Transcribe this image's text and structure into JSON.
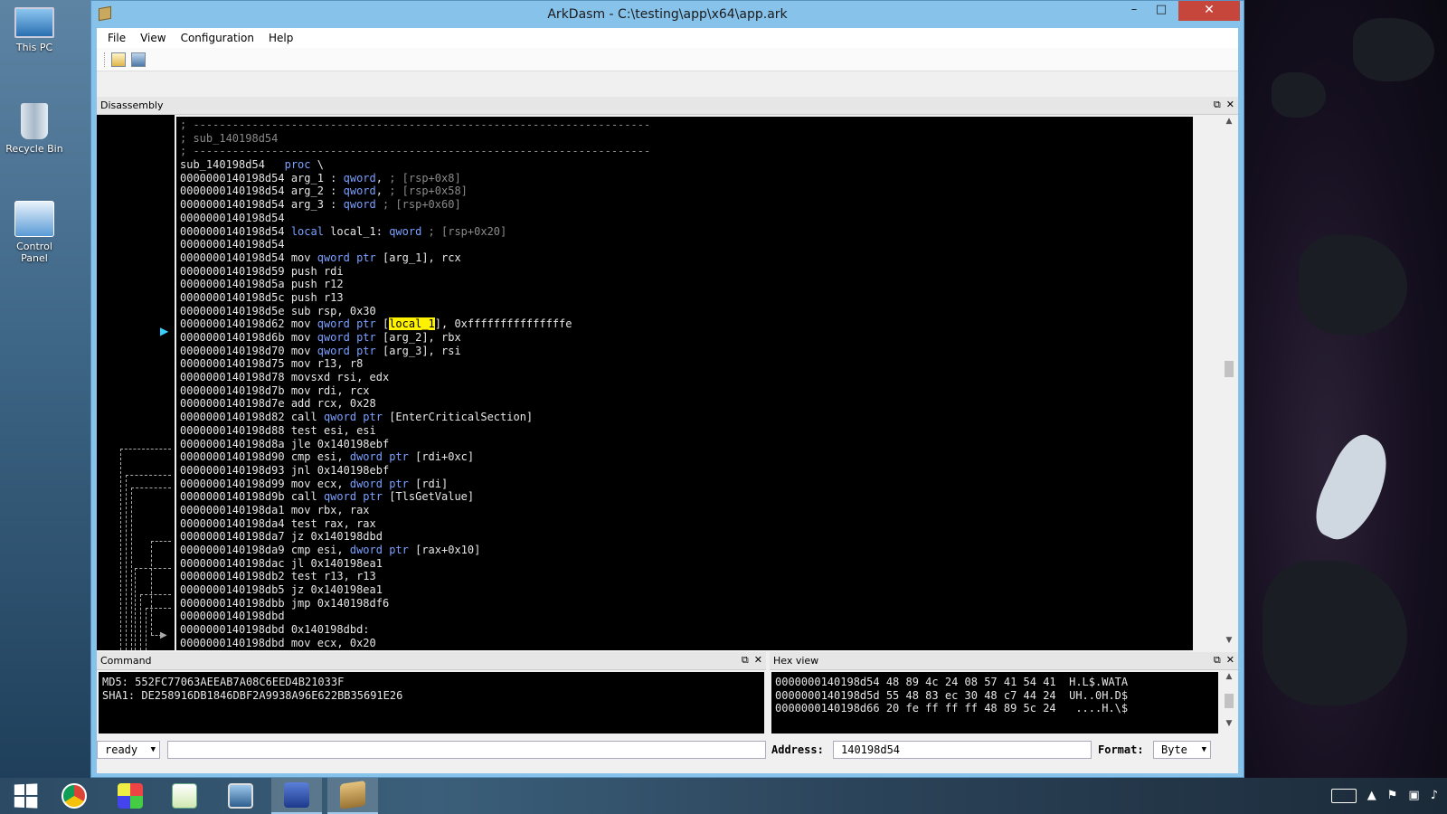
{
  "desktop": {
    "icons": [
      "This PC",
      "Recycle Bin",
      "Control Panel"
    ]
  },
  "window": {
    "title": "ArkDasm - C:\\testing\\app\\x64\\app.ark",
    "controls": {
      "minimize": "–",
      "maximize": "□",
      "close": "✕"
    }
  },
  "menu": [
    "File",
    "View",
    "Configuration",
    "Help"
  ],
  "toolbar": {
    "icons": [
      "open-icon",
      "save-icon"
    ]
  },
  "disassembly": {
    "title": "Disassembly",
    "header_icons": [
      "⧉",
      "✕"
    ],
    "lines": [
      {
        "t": "cmt",
        "text": "; ----------------------------------------------------------------------"
      },
      {
        "t": "cmt",
        "text": "; sub_140198d54"
      },
      {
        "t": "cmt",
        "text": "; ----------------------------------------------------------------------"
      },
      {
        "t": "proc",
        "addr": "sub_140198d54",
        "kw": "proc",
        "rest": " \\"
      },
      {
        "t": "arg",
        "addr": "0000000140198d54",
        "a": " arg_1 : ",
        "kw": "qword",
        "b": ", ",
        "cmt": "; [rsp+0x8]"
      },
      {
        "t": "arg",
        "addr": "0000000140198d54",
        "a": " arg_2 : ",
        "kw": "qword",
        "b": ", ",
        "cmt": "; [rsp+0x58]"
      },
      {
        "t": "arg",
        "addr": "0000000140198d54",
        "a": " arg_3 : ",
        "kw": "qword",
        "b": " ",
        "cmt": "; [rsp+0x60]"
      },
      {
        "t": "plain",
        "text": "0000000140198d54"
      },
      {
        "t": "local",
        "addr": "0000000140198d54",
        "kw1": "local",
        "a": " local_1: ",
        "kw": "qword",
        "cmt": " ; [rsp+0x20]"
      },
      {
        "t": "plain",
        "text": "0000000140198d54"
      },
      {
        "t": "ptr",
        "addr": "0000000140198d54",
        "op": " mov ",
        "kw": "qword ptr",
        "rest": " [arg_1], rcx"
      },
      {
        "t": "plain",
        "text": "0000000140198d59 push rdi"
      },
      {
        "t": "plain",
        "text": "0000000140198d5a push r12"
      },
      {
        "t": "plain",
        "text": "0000000140198d5c push r13"
      },
      {
        "t": "plain",
        "text": "0000000140198d5e sub rsp, 0x30"
      },
      {
        "t": "hl",
        "addr": "0000000140198d62",
        "op": " mov ",
        "kw": "qword ptr",
        "pre": " [",
        "hl": "local_1",
        "post": "], 0xfffffffffffffffe"
      },
      {
        "t": "ptr",
        "addr": "0000000140198d6b",
        "op": " mov ",
        "kw": "qword ptr",
        "rest": " [arg_2], rbx"
      },
      {
        "t": "ptr",
        "addr": "0000000140198d70",
        "op": " mov ",
        "kw": "qword ptr",
        "rest": " [arg_3], rsi"
      },
      {
        "t": "plain",
        "text": "0000000140198d75 mov r13, r8"
      },
      {
        "t": "plain",
        "text": "0000000140198d78 movsxd rsi, edx"
      },
      {
        "t": "plain",
        "text": "0000000140198d7b mov rdi, rcx"
      },
      {
        "t": "plain",
        "text": "0000000140198d7e add rcx, 0x28"
      },
      {
        "t": "ptr",
        "addr": "0000000140198d82",
        "op": " call ",
        "kw": "qword ptr",
        "rest": " [EnterCriticalSection]"
      },
      {
        "t": "plain",
        "text": "0000000140198d88 test esi, esi"
      },
      {
        "t": "plain",
        "text": "0000000140198d8a jle 0x140198ebf"
      },
      {
        "t": "ptr",
        "addr": "0000000140198d90",
        "op": " cmp esi, ",
        "kw": "dword ptr",
        "rest": " [rdi+0xc]"
      },
      {
        "t": "plain",
        "text": "0000000140198d93 jnl 0x140198ebf"
      },
      {
        "t": "ptr",
        "addr": "0000000140198d99",
        "op": " mov ecx, ",
        "kw": "dword ptr",
        "rest": " [rdi]"
      },
      {
        "t": "ptr",
        "addr": "0000000140198d9b",
        "op": " call ",
        "kw": "qword ptr",
        "rest": " [TlsGetValue]"
      },
      {
        "t": "plain",
        "text": "0000000140198da1 mov rbx, rax"
      },
      {
        "t": "plain",
        "text": "0000000140198da4 test rax, rax"
      },
      {
        "t": "plain",
        "text": "0000000140198da7 jz 0x140198dbd"
      },
      {
        "t": "ptr",
        "addr": "0000000140198da9",
        "op": " cmp esi, ",
        "kw": "dword ptr",
        "rest": " [rax+0x10]"
      },
      {
        "t": "plain",
        "text": "0000000140198dac jl 0x140198ea1"
      },
      {
        "t": "plain",
        "text": "0000000140198db2 test r13, r13"
      },
      {
        "t": "plain",
        "text": "0000000140198db5 jz 0x140198ea1"
      },
      {
        "t": "plain",
        "text": "0000000140198dbb jmp 0x140198df6"
      },
      {
        "t": "plain",
        "text": "0000000140198dbd"
      },
      {
        "t": "plain",
        "text": "0000000140198dbd 0x140198dbd:"
      },
      {
        "t": "plain",
        "text": "0000000140198dbd mov ecx, 0x20"
      }
    ]
  },
  "command": {
    "title": "Command",
    "header_icons": [
      "⧉",
      "✕"
    ],
    "output": "MD5: 552FC77063AEEAB7A08C6EED4B21033F\nSHA1: DE258916DB1846DBF2A9938A96E622BB35691E26"
  },
  "hexview": {
    "title": "Hex view",
    "header_icons": [
      "⧉",
      "✕"
    ],
    "output": "0000000140198d54 48 89 4c 24 08 57 41 54 41  H.L$.WATA\n0000000140198d5d 55 48 83 ec 30 48 c7 44 24  UH..0H.D$\n0000000140198d66 20 fe ff ff ff 48 89 5c 24   ....H.\\$"
  },
  "statusbar": {
    "state": "ready",
    "command_input": "",
    "address_label": "Address:",
    "address_value": "140198d54",
    "format_label": "Format:",
    "format_value": "Byte"
  },
  "taskbar": {
    "apps": [
      "start-icon",
      "chrome-icon",
      "paint-icon",
      "notepad-icon",
      "monitor-icon",
      "floppy-icon",
      "arkdasm-icon"
    ]
  },
  "colors": {
    "keyword": "#7aa0ff",
    "comment": "#8a8a8a",
    "highlight": "#fff200",
    "titlebar": "#87c2ea",
    "close": "#c7463c"
  }
}
